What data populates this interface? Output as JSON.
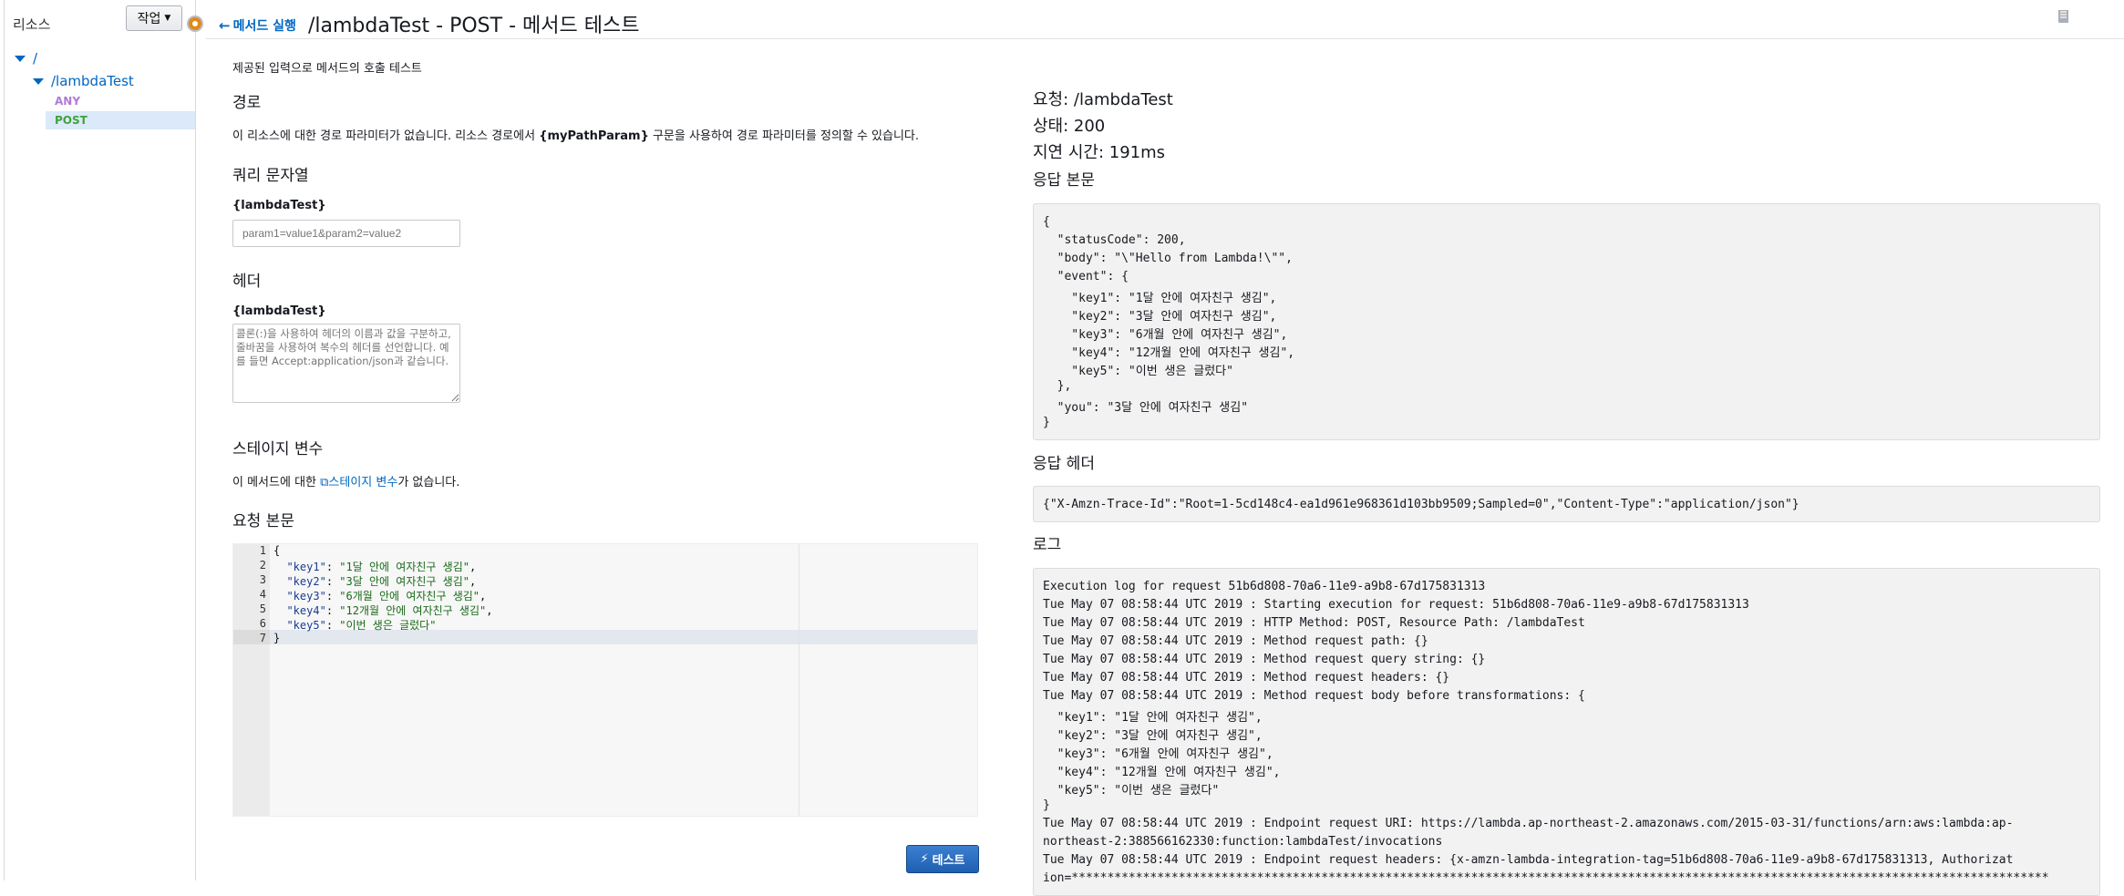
{
  "sidebar": {
    "title": "리소스",
    "action_label": "작업",
    "tree": [
      {
        "label": "/",
        "level": 0
      },
      {
        "label": "/lambdaTest",
        "level": 1
      },
      {
        "label": "ANY",
        "level": 2,
        "color": "#b07ad9"
      },
      {
        "label": "POST",
        "level": 2,
        "color": "#3fa33a",
        "selected": true
      }
    ]
  },
  "header": {
    "back_label": "메서드 실행",
    "title": "/lambdaTest - POST - 메서드 테스트"
  },
  "form": {
    "intro": "제공된 입력으로 메서드의 호출 테스트",
    "path_heading": "경로",
    "path_text_before": "이 리소스에 대한 경로 파라미터가 없습니다. 리소스 경로에서 ",
    "path_text_bold": "{myPathParam}",
    "path_text_after": " 구문을 사용하여 경로 파라미터를 정의할 수 있습니다.",
    "query_heading": "쿼리 문자열",
    "query_label": "{lambdaTest}",
    "query_placeholder": "param1=value1&param2=value2",
    "headers_heading": "헤더",
    "headers_label": "{lambdaTest}",
    "headers_placeholder": "콜론(:)을 사용하여 헤더의 이름과 값을 구분하고, 줄바꿈을 사용하여 복수의 헤더를 선언합니다. 예를 들면 Accept:application/json과 같습니다.",
    "stage_heading": "스테이지 변수",
    "stage_text_before": "이 메서드에 대한 ",
    "stage_link": "스테이지 변수",
    "stage_text_after": "가 없습니다.",
    "body_heading": "요청 본문",
    "body_lines": [
      "{",
      "  \"key1\": \"1달 안에 여자친구 생김\",",
      "  \"key2\": \"3달 안에 여자친구 생김\",",
      "  \"key3\": \"6개월 안에 여자친구 생김\",",
      "  \"key4\": \"12개월 안에 여자친구 생김\",",
      "  \"key5\": \"이번 생은 글렀다\"",
      "}"
    ],
    "line_numbers": [
      "1",
      "2",
      "3",
      "4",
      "5",
      "6",
      "7"
    ],
    "test_label": "테스트"
  },
  "result": {
    "request": "요청: /lambdaTest",
    "status": "상태: 200",
    "latency": "지연 시간: 191ms",
    "body_heading": "응답 본문",
    "body_lines": [
      "{",
      "  \"statusCode\": 200,",
      "  \"body\": \"\\\"Hello from Lambda!\\\"\",",
      "  \"event\": {",
      "    \"key1\": \"1달 안에 여자친구 생김\",",
      "    \"key2\": \"3달 안에 여자친구 생김\",",
      "    \"key3\": \"6개월 안에 여자친구 생김\",",
      "    \"key4\": \"12개월 안에 여자친구 생김\",",
      "    \"key5\": \"이번 생은 글렀다\"",
      "  },",
      "  \"you\": \"3달 안에 여자친구 생김\"",
      "}"
    ],
    "headers_heading": "응답 헤더",
    "headers_value": "{\"X-Amzn-Trace-Id\":\"Root=1-5cd148c4-ea1d961e968361d103bb9509;Sampled=0\",\"Content-Type\":\"application/json\"}",
    "log_heading": "로그",
    "log_lines": [
      "Execution log for request 51b6d808-70a6-11e9-a9b8-67d175831313",
      "Tue May 07 08:58:44 UTC 2019 : Starting execution for request: 51b6d808-70a6-11e9-a9b8-67d175831313",
      "Tue May 07 08:58:44 UTC 2019 : HTTP Method: POST, Resource Path: /lambdaTest",
      "Tue May 07 08:58:44 UTC 2019 : Method request path: {}",
      "Tue May 07 08:58:44 UTC 2019 : Method request query string: {}",
      "Tue May 07 08:58:44 UTC 2019 : Method request headers: {}",
      "Tue May 07 08:58:44 UTC 2019 : Method request body before transformations: {",
      "  \"key1\": \"1달 안에 여자친구 생김\",",
      "  \"key2\": \"3달 안에 여자친구 생김\",",
      "  \"key3\": \"6개월 안에 여자친구 생김\",",
      "  \"key4\": \"12개월 안에 여자친구 생김\",",
      "  \"key5\": \"이번 생은 글렀다\"",
      "}",
      "Tue May 07 08:58:44 UTC 2019 : Endpoint request URI: https://lambda.ap-northeast-2.amazonaws.com/2015-03-31/functions/arn:aws:lambda:ap-",
      "northeast-2:388566162330:function:lambdaTest/invocations",
      "Tue May 07 08:58:44 UTC 2019 : Endpoint request headers: {x-amzn-lambda-integration-tag=51b6d808-70a6-11e9-a9b8-67d175831313, Authorizat",
      "ion=*****************************************************************************************************************************************"
    ]
  }
}
